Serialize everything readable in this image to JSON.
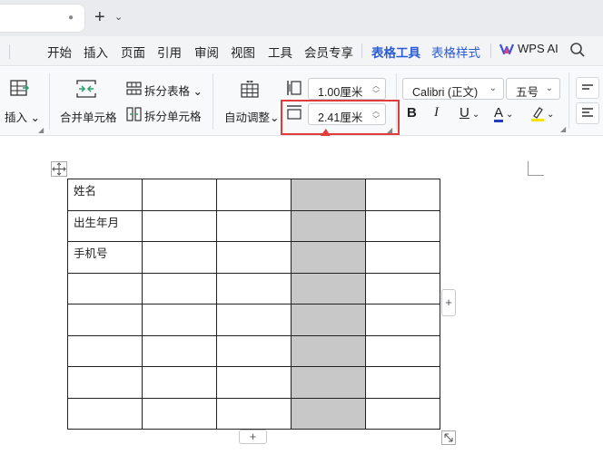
{
  "tabbar": {
    "new_tab_symbol": "+",
    "dot": "●",
    "caret": "⌄"
  },
  "menu": {
    "items": [
      "开始",
      "插入",
      "页面",
      "引用",
      "审阅",
      "视图",
      "工具",
      "会员专享"
    ],
    "active_tab": "表格工具",
    "second_tab": "表格样式",
    "wps_ai": "WPS AI"
  },
  "ribbon": {
    "insert_label": "插入",
    "merge_cells": "合并单元格",
    "split_table": "拆分表格",
    "split_cells": "拆分单元格",
    "auto_fit": "自动调整",
    "cell_width": "1.00厘米",
    "cell_height": "2.41厘米",
    "font_name": "Calibri (正文)",
    "font_size": "五号",
    "bold": "B",
    "italic": "I",
    "underline": "U",
    "font_color_letter": "A",
    "highlight_letter": "A",
    "colors": {
      "font_color_bar": "#1f3fbf",
      "highlight_bar": "#f2e600",
      "accent": "#2a5bd7",
      "highlight_box": "#e23b3b"
    }
  },
  "table": {
    "rows": [
      [
        "姓名",
        "",
        "",
        "",
        ""
      ],
      [
        "出生年月",
        "",
        "",
        "",
        ""
      ],
      [
        "手机号",
        "",
        "",
        "",
        ""
      ],
      [
        "",
        "",
        "",
        "",
        ""
      ],
      [
        "",
        "",
        "",
        "",
        ""
      ],
      [
        "",
        "",
        "",
        "",
        ""
      ],
      [
        "",
        "",
        "",
        "",
        ""
      ],
      [
        "",
        "",
        "",
        "",
        ""
      ]
    ],
    "shaded_column": 3
  },
  "handles": {
    "add": "+"
  }
}
